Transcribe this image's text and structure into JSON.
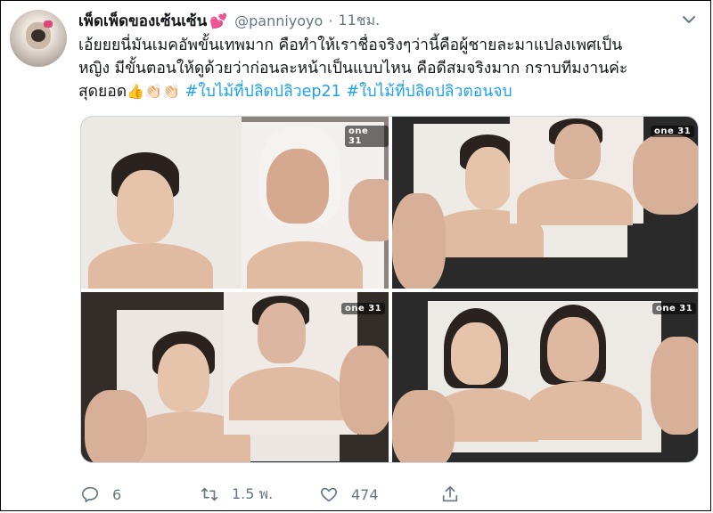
{
  "tweet": {
    "display_name": "เพ็ดเพ็ดของเซ้นเซ้น",
    "name_emoji": "💕",
    "handle": "@panniyoyo",
    "separator": "·",
    "time": "11ชม.",
    "text_lines": [
      "เอ้ยยยนี่มันเมคอัพขั้นเทพมาก คือทำให้เราชื่อจริงๆว่านี้คือผู้ชายละมาแปลงเพศเป็น",
      "หญิง มีขั้นตอนให้ดูด้วยว่าก่อนละหน้าเป็นแบบไหน คือดีสมจริงมาก กราบทีมงานค่ะ",
      "สุดยอด"
    ],
    "emojis": "👍👏🏻👏🏻",
    "hashtags": [
      "#ใบไม้ที่ปลิดปลิวep21",
      "#ใบไม้ที่ปลิดปลิวตอนจบ"
    ],
    "image_logos": [
      "one 31",
      "one 31",
      "one 31",
      "one 31"
    ]
  },
  "actions": {
    "reply_count": "6",
    "retweet_count": "1.5 พ.",
    "like_count": "474"
  },
  "icons": {
    "menu": "chevron-down-icon",
    "reply": "reply-icon",
    "retweet": "retweet-icon",
    "like": "heart-icon",
    "share": "share-icon"
  },
  "colors": {
    "link": "#1da1f2",
    "muted": "#657786",
    "text": "#14171a"
  }
}
